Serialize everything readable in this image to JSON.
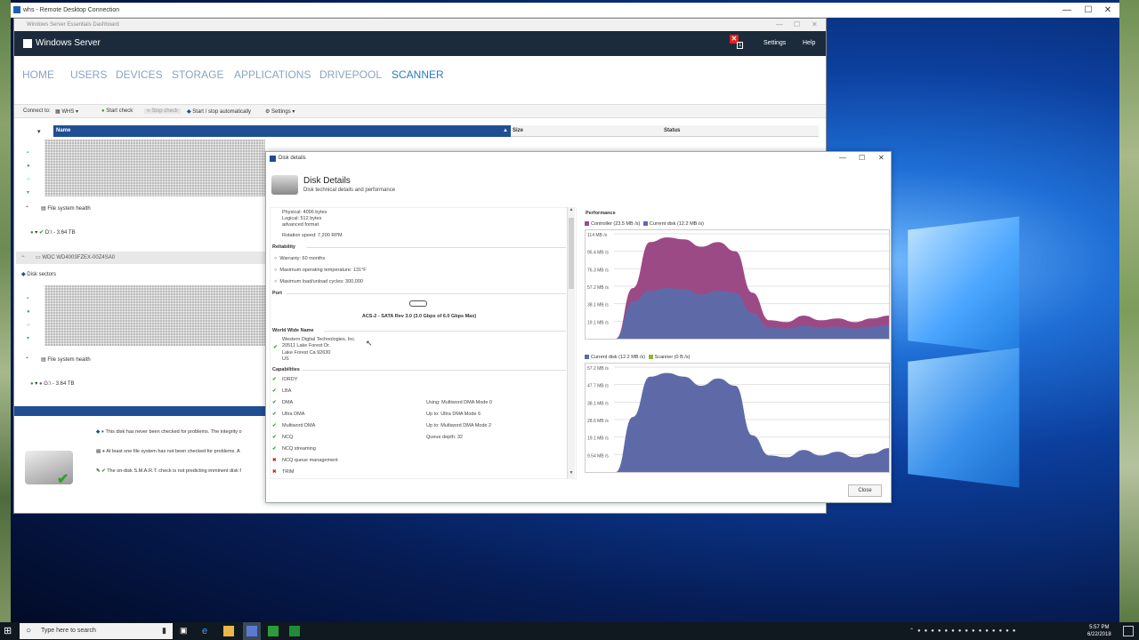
{
  "rdp": {
    "title": "whs - Remote Desktop Connection"
  },
  "dashboard": {
    "title": "Windows Server Essentials Dashboard",
    "brand": "Windows Server",
    "settings": "Settings",
    "help": "Help",
    "alert_count": "1",
    "nav": [
      "HOME",
      "USERS",
      "DEVICES",
      "STORAGE",
      "APPLICATIONS",
      "DRIVEPOOL",
      "SCANNER"
    ],
    "toolbar": {
      "connect": "Connect to:",
      "server": "WHS",
      "start": "Start check",
      "stop": "Stop check",
      "auto": "Start / stop automatically",
      "settings": "Settings"
    },
    "grid": {
      "name": "Name",
      "size": "Size",
      "status": "Status"
    },
    "rows": {
      "fs_health_1": "File system health",
      "vol1": "D:\\ - 3.64 TB",
      "disk2": "WDC WD4003FZEX-00Z4SA0",
      "disk_sectors": "Disk sectors",
      "fs_health_2": "File system health",
      "vol2": "G:\\ - 3.64 TB"
    },
    "messages": [
      "This disk has never been checked for problems. The integrity o",
      "At least one file system has not been checked for problems. A",
      "The on-disk S.M.A.R.T. check is not predicting imminent disk f"
    ]
  },
  "dialog": {
    "title": "Disk details",
    "heading": "Disk Details",
    "subheading": "Disk technical details and performance",
    "top_lines": [
      "Physical: 4096 bytes",
      "Logical: 512 bytes",
      "advanced format",
      "Rotation speed: 7,200 RPM"
    ],
    "reliability": {
      "label": "Reliability",
      "items": [
        "Warranty: 60 months",
        "Maximum operating temperature: 131°F",
        "Maximum load/unload cycles: 300,000"
      ]
    },
    "port": {
      "label": "Port",
      "value": "ACS-2 - SATA Rev 3.0 (3.0 Gbps of 6.0 Gbps Max)"
    },
    "wwn": {
      "label": "World Wide Name",
      "lines": [
        "Western Digital Technologies, Inc.",
        "20511 Lake Forest Dr.",
        "Lake Forest  Ca  92630",
        "US"
      ]
    },
    "capabilities": {
      "label": "Capabilities",
      "items": [
        {
          "name": "IORDY",
          "ok": true,
          "detail": ""
        },
        {
          "name": "LBA",
          "ok": true,
          "detail": ""
        },
        {
          "name": "DMA",
          "ok": true,
          "detail": "Using: Multiword DMA Mode 0"
        },
        {
          "name": "Ultra DMA",
          "ok": true,
          "detail": "Up to: Ultra DMA Mode 6"
        },
        {
          "name": "Multiword DMA",
          "ok": true,
          "detail": "Up to: Multiword DMA Mode 2"
        },
        {
          "name": "NCQ",
          "ok": true,
          "detail": "Queue depth: 32"
        },
        {
          "name": "NCQ streaming",
          "ok": true,
          "detail": ""
        },
        {
          "name": "NCQ queue management",
          "ok": false,
          "detail": ""
        },
        {
          "name": "TRIM",
          "ok": false,
          "detail": ""
        }
      ]
    },
    "performance": {
      "label": "Performance",
      "legend1": [
        "Controller (23.5 MB /s)",
        "Current disk (12.2 MB /s)"
      ],
      "legend2": [
        "Current disk (12.2 MB /s)",
        "Scanner (0 B /s)"
      ]
    },
    "close": "Close",
    "colors": {
      "controller": "#9c4a86",
      "disk": "#5e6aa8",
      "scanner": "#8fb53a"
    }
  },
  "chart_data": [
    {
      "type": "area",
      "ylim": [
        0,
        114
      ],
      "yticks": [
        "114 MB /s",
        "95.4 MB /s",
        "76.3 MB /s",
        "57.2 MB /s",
        "38.1 MB /s",
        "19.1 MB /s"
      ],
      "series": [
        {
          "name": "Controller (23.5 MB /s)",
          "values": [
            0,
            55,
            105,
            110,
            108,
            100,
            105,
            95,
            50,
            20,
            18,
            25,
            20,
            22,
            18,
            22,
            25
          ]
        },
        {
          "name": "Current disk (12.2 MB /s)",
          "values": [
            0,
            40,
            52,
            55,
            54,
            48,
            52,
            50,
            28,
            12,
            11,
            14,
            12,
            13,
            11,
            13,
            15
          ]
        }
      ]
    },
    {
      "type": "area",
      "ylim": [
        0,
        57.2
      ],
      "yticks": [
        "57.2 MB /s",
        "47.7 MB /s",
        "38.1 MB /s",
        "28.6 MB /s",
        "19.1 MB /s",
        "9.54 MB /s"
      ],
      "series": [
        {
          "name": "Current disk (12.2 MB /s)",
          "values": [
            0,
            30,
            52,
            54,
            52,
            47,
            51,
            47,
            20,
            9,
            8,
            12,
            9,
            11,
            8,
            10,
            13
          ]
        },
        {
          "name": "Scanner (0 B /s)",
          "values": [
            0,
            0,
            0,
            0,
            0,
            0,
            0,
            0,
            0,
            0,
            0,
            0,
            0,
            0,
            0,
            0,
            0
          ]
        }
      ]
    }
  ],
  "taskbar": {
    "search": "Type here to search",
    "time": "5:57 PM",
    "date": "6/22/2018"
  }
}
